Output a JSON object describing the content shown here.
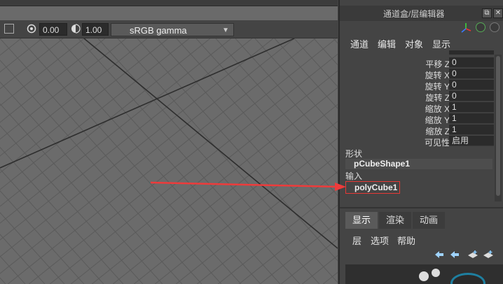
{
  "viewport_toolbar": {
    "exposure": "0.00",
    "gamma": "1.00",
    "color_space": "sRGB gamma"
  },
  "panel": {
    "title": "通道盒/层编辑器",
    "menu": [
      "通道",
      "编辑",
      "对象",
      "显示"
    ],
    "attributes": [
      {
        "label": "平移 Z",
        "value": "0"
      },
      {
        "label": "旋转 X",
        "value": "0"
      },
      {
        "label": "旋转 Y",
        "value": "0"
      },
      {
        "label": "旋转 Z",
        "value": "0"
      },
      {
        "label": "缩放 X",
        "value": "1"
      },
      {
        "label": "缩放 Y",
        "value": "1"
      },
      {
        "label": "缩放 Z",
        "value": "1"
      },
      {
        "label": "可见性",
        "value": "启用"
      }
    ],
    "shapes_heading": "形状",
    "shape_node": "pCubeShape1",
    "inputs_heading": "输入",
    "input_node": "polyCube1"
  },
  "layer_editor": {
    "tabs": [
      "显示",
      "渲染",
      "动画"
    ],
    "menu": [
      "层",
      "选项",
      "帮助"
    ]
  },
  "colors": {
    "highlight_box": "#e53935",
    "arrow": "#ee3b3b"
  }
}
